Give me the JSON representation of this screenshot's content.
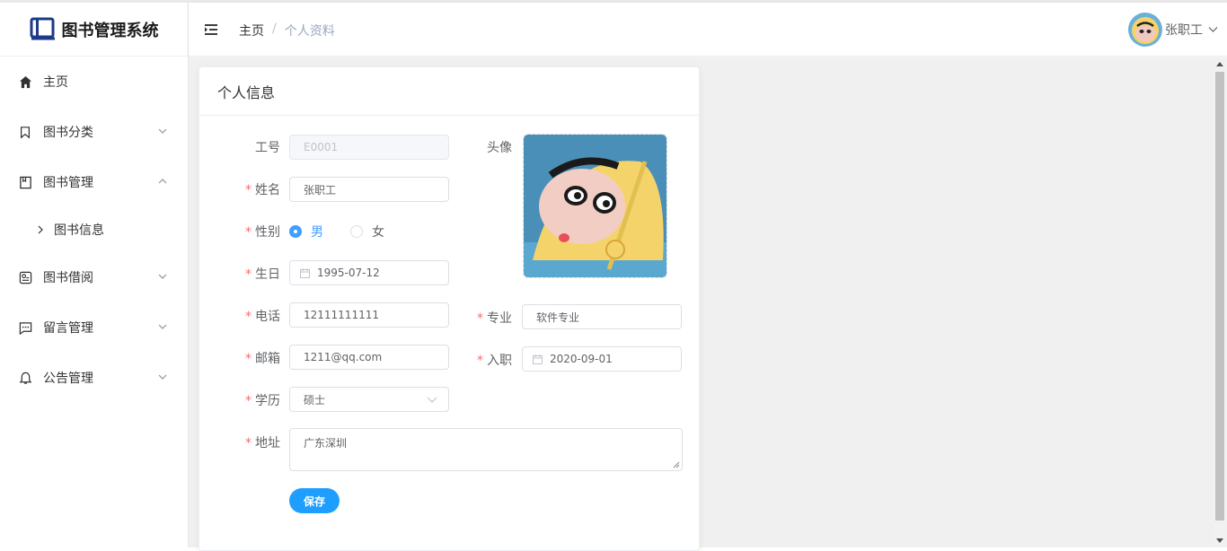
{
  "app": {
    "title": "图书管理系统"
  },
  "sidebar": {
    "items": [
      {
        "label": "主页",
        "icon": "home-icon"
      },
      {
        "label": "图书分类",
        "icon": "bookmark-icon"
      },
      {
        "label": "图书管理",
        "icon": "book-icon"
      },
      {
        "label": "图书信息",
        "icon": "chevron-right-icon"
      },
      {
        "label": "图书借阅",
        "icon": "borrow-icon"
      },
      {
        "label": "留言管理",
        "icon": "chat-icon"
      },
      {
        "label": "公告管理",
        "icon": "bell-icon"
      }
    ]
  },
  "header": {
    "breadcrumb": [
      "主页",
      "个人资料"
    ],
    "breadcrumb_sep": "/",
    "user_name": "张职工"
  },
  "card": {
    "title": "个人信息"
  },
  "form": {
    "labels": {
      "id": "工号",
      "name": "姓名",
      "gender": "性别",
      "birthday": "生日",
      "phone": "电话",
      "email": "邮箱",
      "education": "学历",
      "address": "地址",
      "avatar": "头像",
      "major": "专业",
      "hire_date": "入职"
    },
    "required_mark": "*",
    "values": {
      "id": "E0001",
      "name": "张职工",
      "birthday": "1995-07-12",
      "phone": "12111111111",
      "email": "1211@qq.com",
      "education": "硕士",
      "address": "广东深圳",
      "major": "软件专业",
      "hire_date": "2020-09-01"
    },
    "gender_options": [
      "男",
      "女"
    ],
    "gender_selected": "男",
    "save_label": "保存"
  },
  "colors": {
    "primary": "#409eff",
    "save_button": "#1e9fff",
    "required": "#f56c6c"
  }
}
